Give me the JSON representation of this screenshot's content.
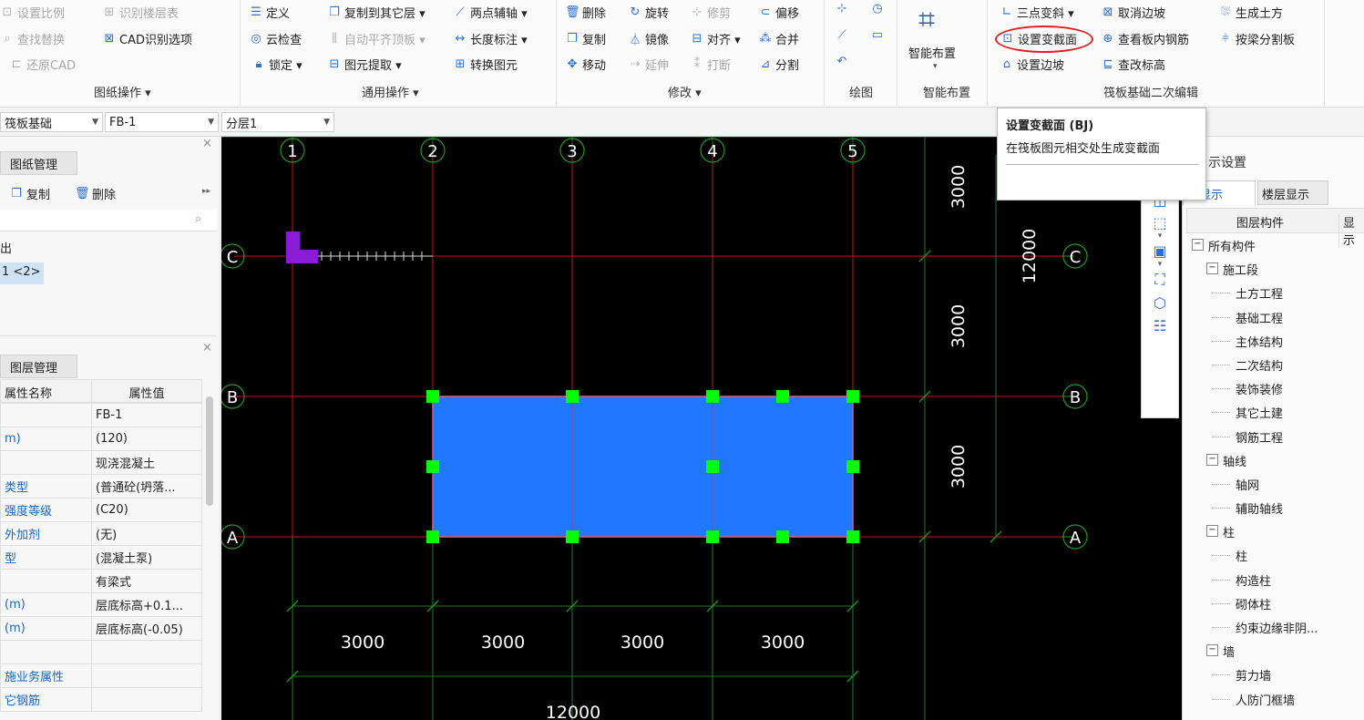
{
  "ribbon": {
    "groups": [
      {
        "label": "图纸操作 ▾"
      },
      {
        "label": "通用操作 ▾"
      },
      {
        "label": "修改 ▾"
      },
      {
        "label": "绘图"
      },
      {
        "label": "智能布置"
      },
      {
        "label": "筏板基础二次编辑"
      }
    ],
    "drawing_ops": [
      "设置比例",
      "识别楼层表",
      "查找替换",
      "CAD识别选项",
      "还原CAD"
    ],
    "general_ops": [
      "定义",
      "复制到其它层 ▾",
      "两点辅轴 ▾",
      "云检查",
      "自动平齐顶板 ▾",
      "长度标注 ▾",
      "锁定 ▾",
      "图元提取 ▾",
      "转换图元"
    ],
    "modify_ops": [
      "删除",
      "旋转",
      "修剪",
      "偏移",
      "复制",
      "镜像",
      "对齐 ▾",
      "合并",
      "移动",
      "延伸",
      "打断",
      "分割"
    ],
    "smart_layout": "智能布置",
    "raft_ops": [
      "三点变斜 ▾",
      "取消边坡",
      "生成土方",
      "设置变截面",
      "查看板内钢筋",
      "按梁分割板",
      "设置边坡",
      "查改标高"
    ]
  },
  "selectors": {
    "type": "筏板基础",
    "name": "FB-1",
    "layer": "分层1"
  },
  "drawing_panel": {
    "tab": "图纸管理",
    "copy": "复制",
    "delete": "删除",
    "tree_label": "出",
    "selected_item": "1 <2>"
  },
  "layer_panel": {
    "tab": "图层管理",
    "header_name": "属性名称",
    "header_value": "属性值",
    "rows": [
      {
        "name": "",
        "value": "FB-1"
      },
      {
        "name": "m)",
        "value": "(120)"
      },
      {
        "name": "",
        "value": "现浇混凝土"
      },
      {
        "name": "类型",
        "value": "(普通砼(坍落..."
      },
      {
        "name": "强度等级",
        "value": "(C20)"
      },
      {
        "name": "外加剂",
        "value": "(无)"
      },
      {
        "name": "型",
        "value": "(混凝土泵)"
      },
      {
        "name": "",
        "value": "有梁式"
      },
      {
        "name": "(m)",
        "value": "层底标高+0.1..."
      },
      {
        "name": "(m)",
        "value": "层底标高(-0.05)"
      },
      {
        "name": "",
        "value": ""
      },
      {
        "name": "施业务属性",
        "value": ""
      },
      {
        "name": "它钢筋",
        "value": ""
      }
    ]
  },
  "canvas": {
    "axes_x": [
      "1",
      "2",
      "3",
      "4",
      "5"
    ],
    "axes_y": [
      "C",
      "B",
      "A"
    ],
    "dims_bottom": [
      "3000",
      "3000",
      "3000",
      "3000"
    ],
    "dim_total": "12000",
    "dims_right": [
      "3000",
      "3000",
      "3000"
    ],
    "dim_right_total": "12000",
    "slab_color": "#1f78ff",
    "grip_color": "#00ff00"
  },
  "tooltip": {
    "title": "设置变截面 (BJ)",
    "desc": "在筏板图元相交处生成变截面"
  },
  "display_panel": {
    "title": "示设置",
    "tabs": [
      "元显示",
      "楼层显示"
    ],
    "col_header": "图层构件",
    "col_header2": "显示",
    "tree": [
      {
        "label": "所有构件",
        "level": 0,
        "expand": "−"
      },
      {
        "label": "施工段",
        "level": 1,
        "expand": "−"
      },
      {
        "label": "土方工程",
        "level": 2
      },
      {
        "label": "基础工程",
        "level": 2
      },
      {
        "label": "主体结构",
        "level": 2
      },
      {
        "label": "二次结构",
        "level": 2
      },
      {
        "label": "装饰装修",
        "level": 2
      },
      {
        "label": "其它土建",
        "level": 2
      },
      {
        "label": "钢筋工程",
        "level": 2
      },
      {
        "label": "轴线",
        "level": 1,
        "expand": "−"
      },
      {
        "label": "轴网",
        "level": 2
      },
      {
        "label": "辅助轴线",
        "level": 2
      },
      {
        "label": "柱",
        "level": 1,
        "expand": "−"
      },
      {
        "label": "柱",
        "level": 2
      },
      {
        "label": "构造柱",
        "level": 2
      },
      {
        "label": "砌体柱",
        "level": 2
      },
      {
        "label": "约束边缘非阴...",
        "level": 2
      },
      {
        "label": "墙",
        "level": 1,
        "expand": "−"
      },
      {
        "label": "剪力墙",
        "level": 2
      },
      {
        "label": "人防门框墙",
        "level": 2
      }
    ]
  }
}
